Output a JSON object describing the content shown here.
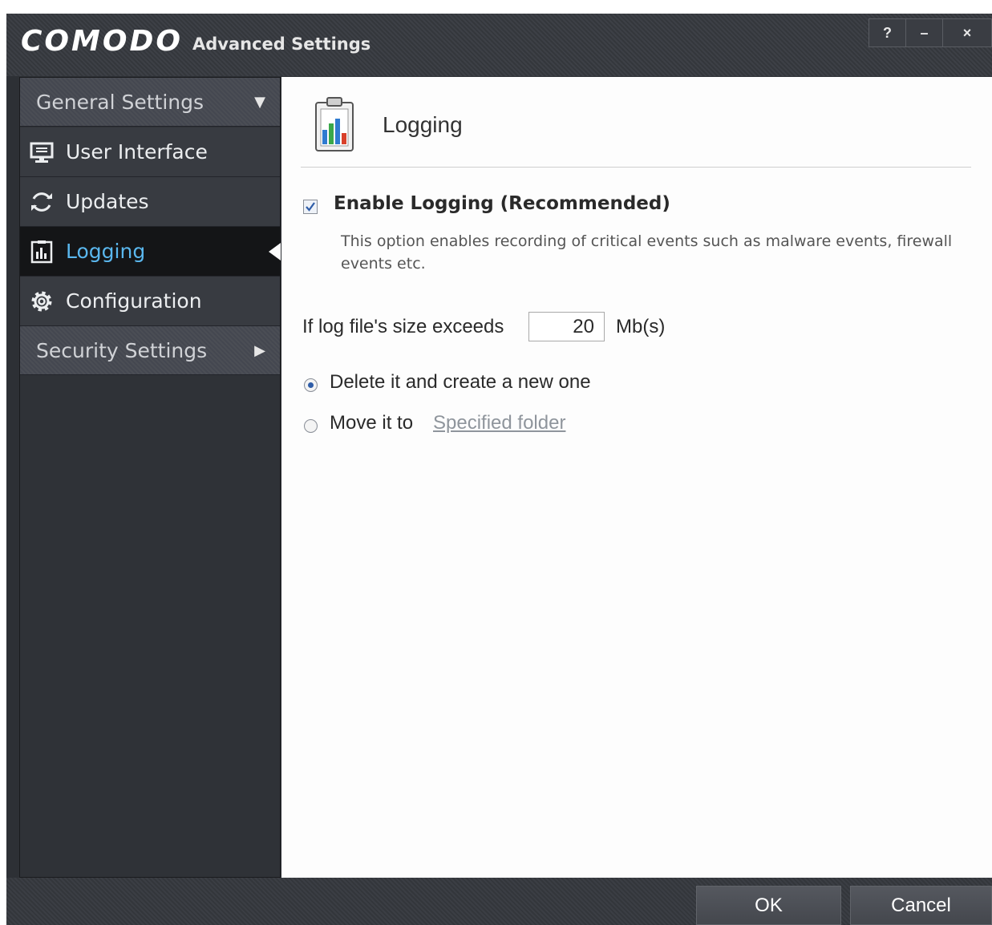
{
  "window": {
    "brand": "COMODO",
    "subtitle": "Advanced Settings",
    "controls": {
      "help": "?",
      "minimize": "–",
      "close": "×"
    }
  },
  "sidebar": {
    "general_group": {
      "label": "General Settings",
      "arrow": "▼"
    },
    "items": [
      {
        "label": "User Interface",
        "icon": "monitor-icon",
        "active": false
      },
      {
        "label": "Updates",
        "icon": "refresh-icon",
        "active": false
      },
      {
        "label": "Logging",
        "icon": "log-chart-icon",
        "active": true
      },
      {
        "label": "Configuration",
        "icon": "gear-icon",
        "active": false
      }
    ],
    "security_group": {
      "label": "Security Settings",
      "arrow": "▶"
    }
  },
  "main": {
    "title": "Logging",
    "enable_logging": {
      "label": "Enable Logging (Recommended)",
      "checked": true,
      "description": "This option enables recording of critical events such as malware events, firewall events etc."
    },
    "size_limit": {
      "label": "If log file's size exceeds",
      "value": "20",
      "unit": "Mb(s)"
    },
    "options": {
      "delete": {
        "label": "Delete it and create a new one",
        "selected": true
      },
      "move": {
        "label": "Move it to",
        "link": "Specified folder",
        "selected": false
      }
    }
  },
  "footer": {
    "ok": "OK",
    "cancel": "Cancel"
  },
  "colors": {
    "active_text": "#5ab7ee",
    "sidebar_bg": "#2f3237",
    "active_bg": "#141517"
  }
}
